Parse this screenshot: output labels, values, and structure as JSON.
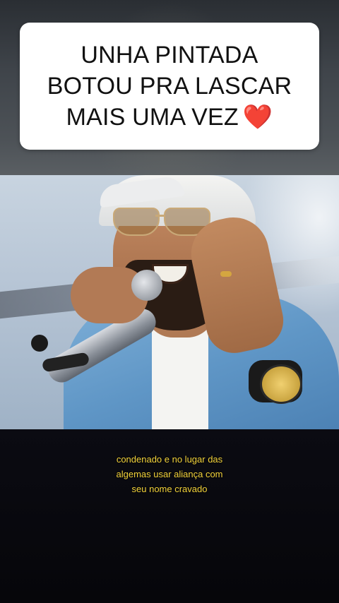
{
  "caption": {
    "lines": [
      "UNHA PINTADA",
      "BOTOU PRA LASCAR",
      "MAIS UMA VEZ"
    ],
    "emoji": "❤️"
  },
  "video": {
    "subtitle_lines": [
      "condenado e no lugar das",
      "algemas usar aliança com",
      "seu nome cravado"
    ],
    "subtitle_color": "#f2d23a"
  },
  "colors": {
    "caption_bg": "#ffffff",
    "caption_text": "#111111",
    "heart": "#e0202e",
    "background": "#000000"
  }
}
